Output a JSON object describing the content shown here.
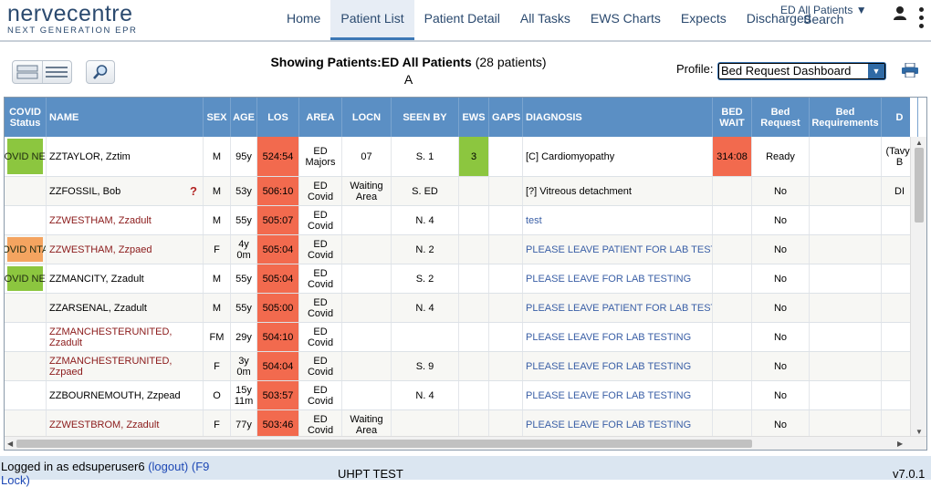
{
  "app": {
    "logo_main": "nervecentre",
    "logo_sub": "NEXT GENERATION EPR"
  },
  "nav": {
    "tabs": [
      {
        "label": "Home",
        "active": false
      },
      {
        "label": "Patient List",
        "active": true
      },
      {
        "label": "Patient Detail",
        "active": false
      },
      {
        "label": "All Tasks",
        "active": false
      },
      {
        "label": "EWS Charts",
        "active": false
      },
      {
        "label": "Expects",
        "active": false
      },
      {
        "label": "Discharged",
        "active": false
      }
    ],
    "context": "ED All Patients ▼",
    "search": "Search",
    "user_icon": "person-icon",
    "menu_icon": "kebab-menu-icon"
  },
  "toolbar": {
    "showing_prefix": "Showing Patients:",
    "showing_group": "ED All Patients",
    "showing_count": "(28 patients)",
    "filter_letter": "A",
    "profile_label": "Profile:",
    "profile_value": "Bed Request Dashboard",
    "icons": [
      "view-toggle-icon",
      "magnifier-icon",
      "printer-icon"
    ]
  },
  "colors": {
    "header_bg": "#5b8fc4",
    "los_red": "#f26a4e",
    "ews_green": "#8cc63f",
    "covid_neg": "#8cc63f",
    "covid_ntap": "#f4a460",
    "link_blue": "#3a5fa6",
    "footer_bg": "#dbe6f1"
  },
  "table": {
    "columns": [
      "COVID Status",
      "NAME",
      "SEX",
      "AGE",
      "LOS",
      "AREA",
      "LOCN",
      "SEEN BY",
      "EWS",
      "GAPS",
      "DIAGNOSIS",
      "BED WAIT",
      "Bed Request",
      "Bed Requirements",
      "D"
    ],
    "rows": [
      {
        "covid": "COVID NEG",
        "covid_color": "#8cc63f",
        "name": "ZZTAYLOR, Zztim",
        "name_red": false,
        "flag": "",
        "sex": "M",
        "age": "95y",
        "los": "524:54",
        "area": "ED Majors",
        "locn": "07",
        "seen_by": "S. 1",
        "ews": "3",
        "gaps": "",
        "diagnosis": "[C] Cardiomyopathy",
        "diag_link": false,
        "bed_wait": "314:08",
        "bed_request": "Ready",
        "bed_req": "",
        "d": "(Tavy) B"
      },
      {
        "covid": "",
        "covid_color": "",
        "name": "ZZFOSSIL, Bob",
        "name_red": false,
        "flag": "?",
        "sex": "M",
        "age": "53y",
        "los": "506:10",
        "area": "ED Covid",
        "locn": "Waiting Area",
        "seen_by": "S. ED",
        "ews": "",
        "gaps": "",
        "diagnosis": "[?] Vitreous detachment",
        "diag_link": false,
        "bed_wait": "",
        "bed_request": "No",
        "bed_req": "",
        "d": "DI"
      },
      {
        "covid": "",
        "covid_color": "",
        "name": "ZZWESTHAM, Zzadult",
        "name_red": true,
        "flag": "",
        "sex": "M",
        "age": "55y",
        "los": "505:07",
        "area": "ED Covid",
        "locn": "",
        "seen_by": "N. 4",
        "ews": "",
        "gaps": "",
        "diagnosis": "test",
        "diag_link": true,
        "bed_wait": "",
        "bed_request": "No",
        "bed_req": "",
        "d": ""
      },
      {
        "covid": "COVID NTAP",
        "covid_color": "#f4a460",
        "name": "ZZWESTHAM, Zzpaed",
        "name_red": true,
        "flag": "",
        "sex": "F",
        "age": "4y 0m",
        "los": "505:04",
        "area": "ED Covid",
        "locn": "",
        "seen_by": "N. 2",
        "ews": "",
        "gaps": "",
        "diagnosis": "PLEASE LEAVE PATIENT FOR LAB TESTING",
        "diag_link": true,
        "bed_wait": "",
        "bed_request": "No",
        "bed_req": "",
        "d": ""
      },
      {
        "covid": "COVID NEG",
        "covid_color": "#8cc63f",
        "name": "ZZMANCITY, Zzadult",
        "name_red": false,
        "flag": "",
        "sex": "M",
        "age": "55y",
        "los": "505:04",
        "area": "ED Covid",
        "locn": "",
        "seen_by": "S. 2",
        "ews": "",
        "gaps": "",
        "diagnosis": "PLEASE LEAVE FOR LAB TESTING",
        "diag_link": true,
        "bed_wait": "",
        "bed_request": "No",
        "bed_req": "",
        "d": ""
      },
      {
        "covid": "",
        "covid_color": "",
        "name": "ZZARSENAL, Zzadult",
        "name_red": false,
        "flag": "",
        "sex": "M",
        "age": "55y",
        "los": "505:00",
        "area": "ED Covid",
        "locn": "",
        "seen_by": "N. 4",
        "ews": "",
        "gaps": "",
        "diagnosis": "PLEASE LEAVE PATIENT FOR LAB TESTING",
        "diag_link": true,
        "bed_wait": "",
        "bed_request": "No",
        "bed_req": "",
        "d": ""
      },
      {
        "covid": "",
        "covid_color": "",
        "name": "ZZMANCHESTERUNITED, Zzadult",
        "name_red": true,
        "flag": "",
        "sex": "FM",
        "age": "29y",
        "los": "504:10",
        "area": "ED Covid",
        "locn": "",
        "seen_by": "",
        "ews": "",
        "gaps": "",
        "diagnosis": "PLEASE LEAVE FOR LAB TESTING",
        "diag_link": true,
        "bed_wait": "",
        "bed_request": "No",
        "bed_req": "",
        "d": ""
      },
      {
        "covid": "",
        "covid_color": "",
        "name": "ZZMANCHESTERUNITED, Zzpaed",
        "name_red": true,
        "flag": "",
        "sex": "F",
        "age": "3y 0m",
        "los": "504:04",
        "area": "ED Covid",
        "locn": "",
        "seen_by": "S. 9",
        "ews": "",
        "gaps": "",
        "diagnosis": "PLEASE LEAVE FOR LAB TESTING",
        "diag_link": true,
        "bed_wait": "",
        "bed_request": "No",
        "bed_req": "",
        "d": ""
      },
      {
        "covid": "",
        "covid_color": "",
        "name": "ZZBOURNEMOUTH, Zzpead",
        "name_red": false,
        "flag": "",
        "sex": "O",
        "age": "15y 11m",
        "los": "503:57",
        "area": "ED Covid",
        "locn": "",
        "seen_by": "N. 4",
        "ews": "",
        "gaps": "",
        "diagnosis": "PLEASE LEAVE FOR LAB TESTING",
        "diag_link": true,
        "bed_wait": "",
        "bed_request": "No",
        "bed_req": "",
        "d": ""
      },
      {
        "covid": "",
        "covid_color": "",
        "name": "ZZWESTBROM, Zzadult",
        "name_red": true,
        "flag": "",
        "sex": "F",
        "age": "77y",
        "los": "503:46",
        "area": "ED Covid",
        "locn": "Waiting Area",
        "seen_by": "",
        "ews": "",
        "gaps": "",
        "diagnosis": "PLEASE LEAVE FOR LAB TESTING",
        "diag_link": true,
        "bed_wait": "",
        "bed_request": "No",
        "bed_req": "",
        "d": ""
      }
    ]
  },
  "footer": {
    "logged_in_prefix": "Logged in as edsuperuser6",
    "logout_label": "(logout)",
    "lock_label": "(F9 Lock)",
    "site": "UHPT TEST",
    "version": "v7.0.1"
  }
}
